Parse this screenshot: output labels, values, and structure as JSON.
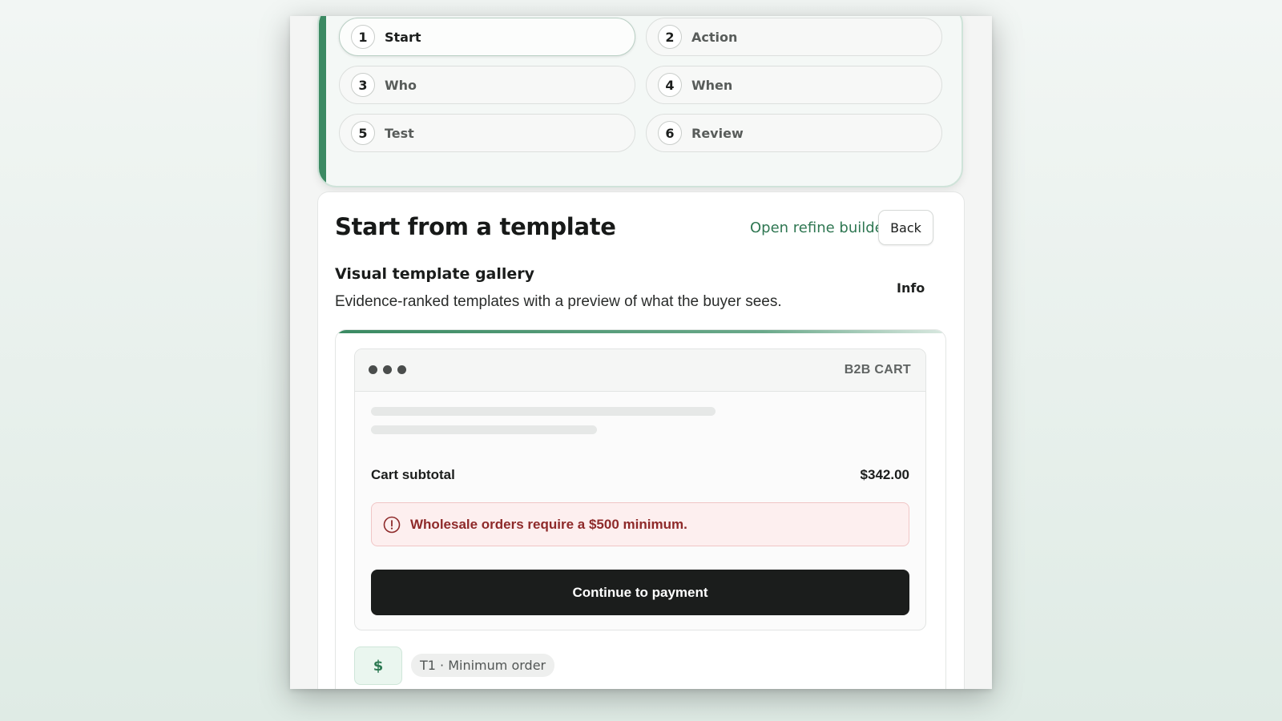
{
  "stepper": {
    "steps": [
      {
        "number": "1",
        "label": "Start",
        "active": true
      },
      {
        "number": "2",
        "label": "Action",
        "active": false
      },
      {
        "number": "3",
        "label": "Who",
        "active": false
      },
      {
        "number": "4",
        "label": "When",
        "active": false
      },
      {
        "number": "5",
        "label": "Test",
        "active": false
      },
      {
        "number": "6",
        "label": "Review",
        "active": false
      }
    ]
  },
  "header": {
    "title": "Start from a template",
    "refine_link": "Open refine builder",
    "back_label": "Back"
  },
  "gallery": {
    "title": "Visual template gallery",
    "description": "Evidence-ranked templates with a preview of what the buyer sees.",
    "info_label": "Info"
  },
  "preview": {
    "tag": "B2B CART",
    "subtotal_label": "Cart subtotal",
    "subtotal_value": "$342.00",
    "alert_text": "Wholesale orders require a $500 minimum.",
    "cta_label": "Continue to payment",
    "badge_symbol": "$",
    "template_label": "T1 · Minimum order"
  },
  "colors": {
    "accent": "#3c8a63",
    "link": "#2f7752",
    "alert_bg": "#fdefef",
    "alert_text": "#8e2a2a",
    "cta_bg": "#1b1d1c"
  }
}
